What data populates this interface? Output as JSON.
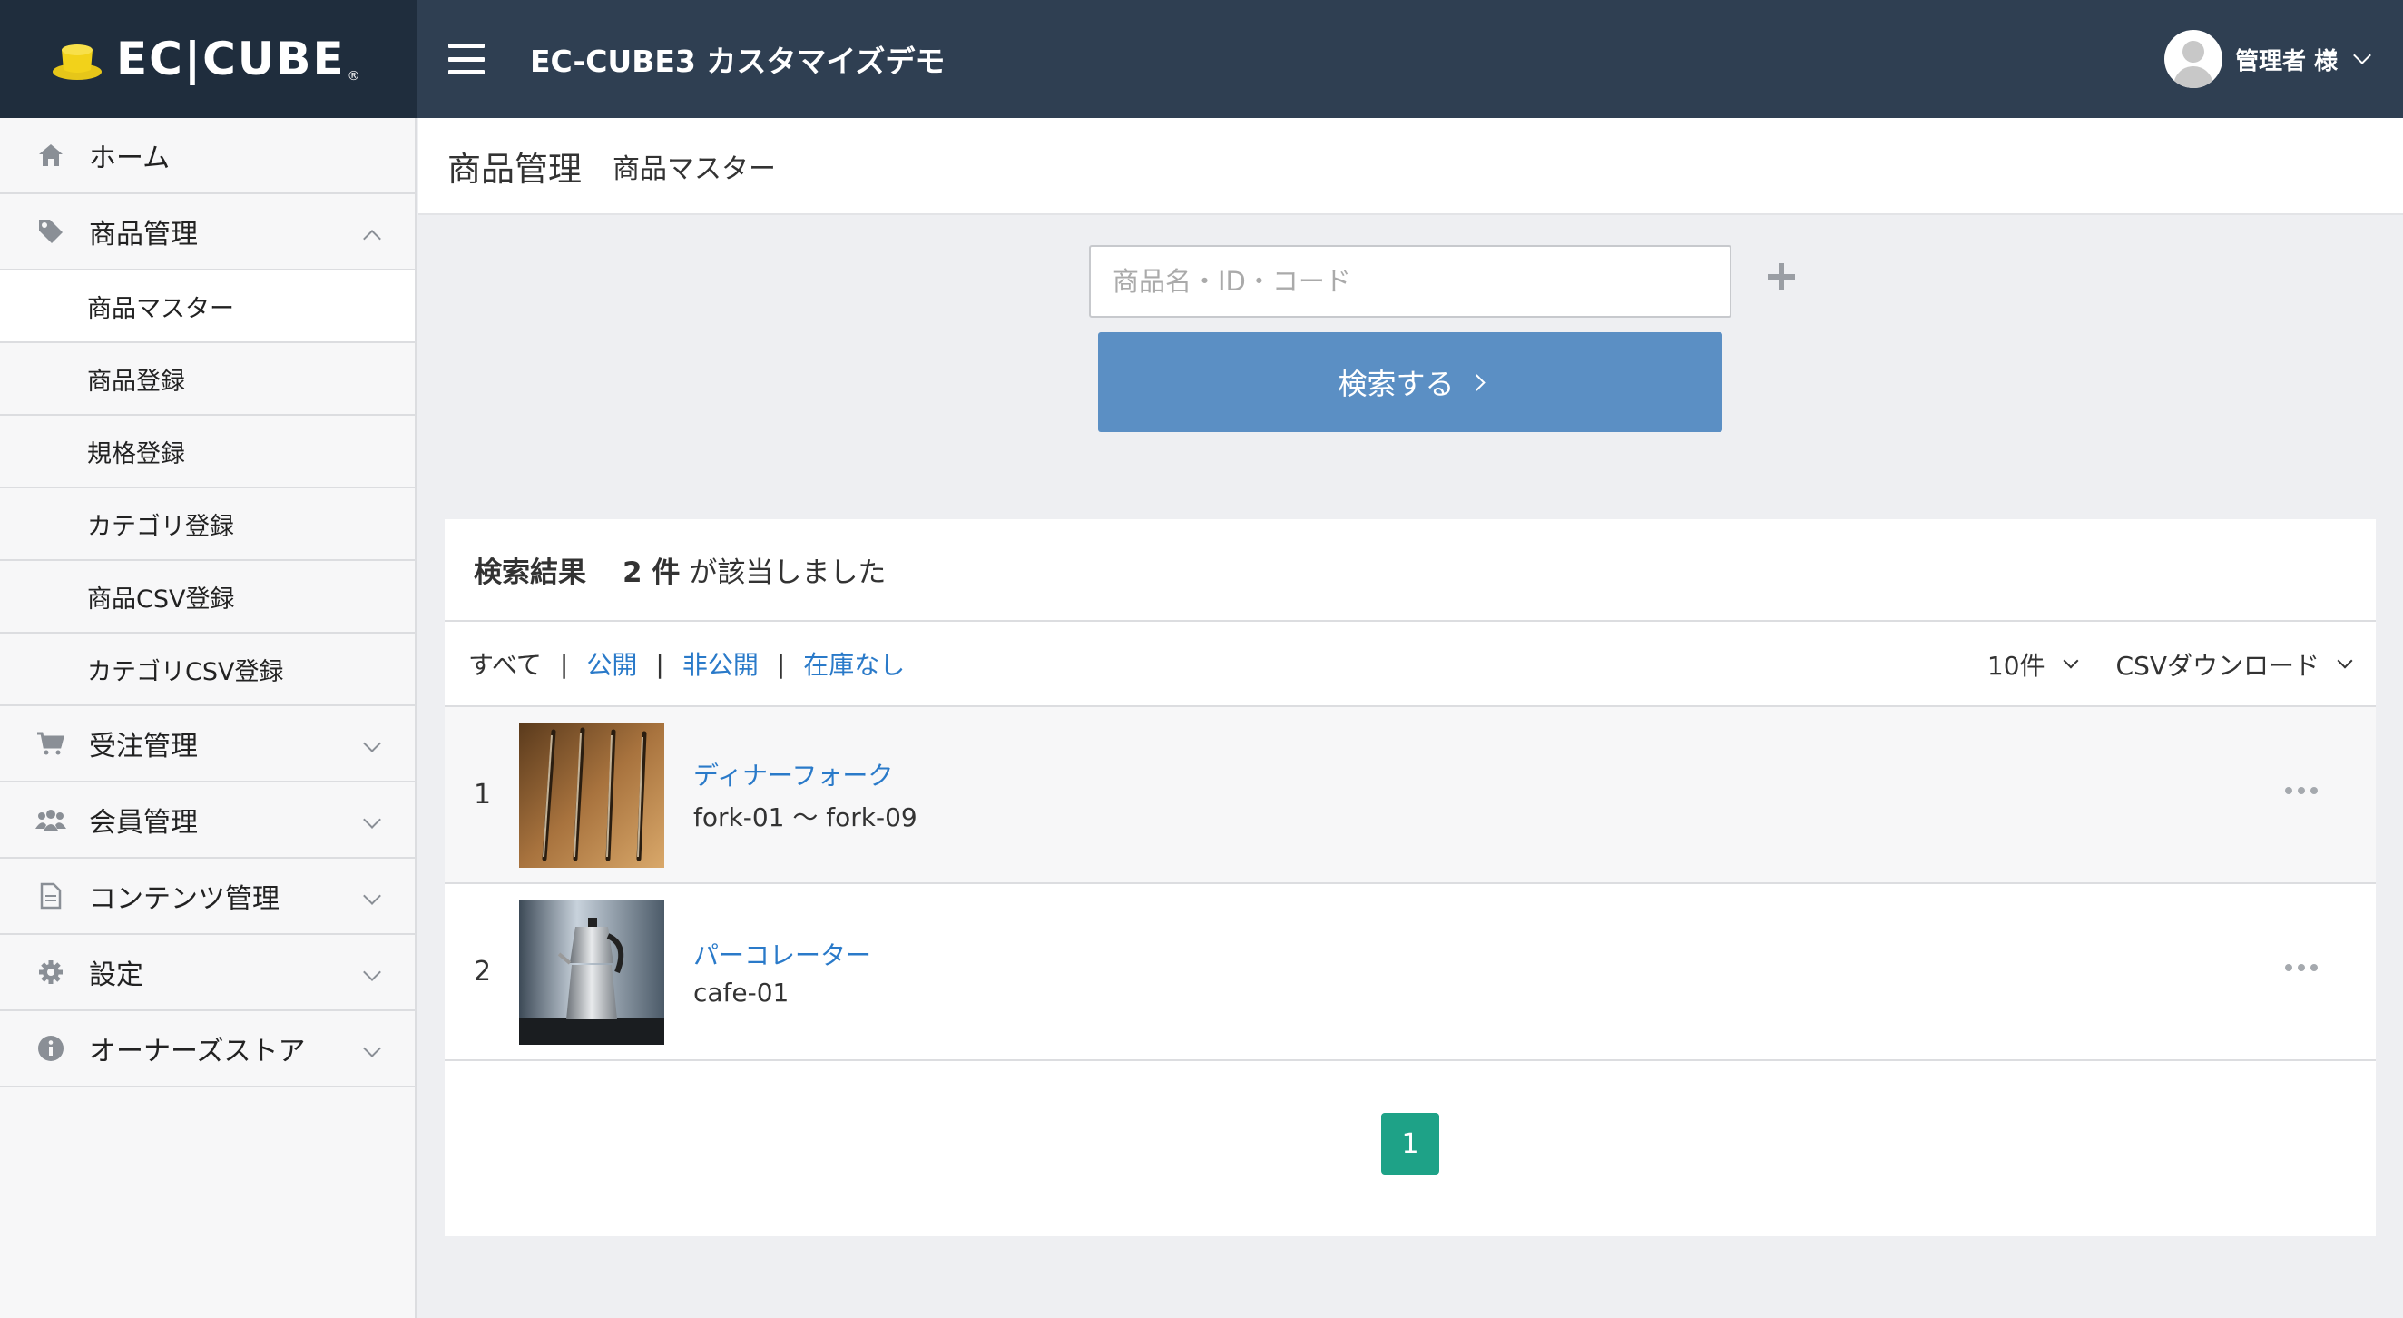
{
  "header": {
    "logo_text": "EC|CUBE",
    "site_title": "EC-CUBE3 カスタマイズデモ",
    "user_name": "管理者 様"
  },
  "sidebar": {
    "items": [
      {
        "label": "ホーム",
        "icon": "home-icon"
      },
      {
        "label": "商品管理",
        "icon": "tag-icon",
        "expanded": true,
        "children": [
          "商品マスター",
          "商品登録",
          "規格登録",
          "カテゴリ登録",
          "商品CSV登録",
          "カテゴリCSV登録"
        ]
      },
      {
        "label": "受注管理",
        "icon": "cart-icon"
      },
      {
        "label": "会員管理",
        "icon": "users-icon"
      },
      {
        "label": "コンテンツ管理",
        "icon": "document-icon"
      },
      {
        "label": "設定",
        "icon": "gear-icon"
      },
      {
        "label": "オーナーズストア",
        "icon": "info-icon"
      }
    ],
    "active_child": "商品マスター"
  },
  "page": {
    "title": "商品管理",
    "subtitle": "商品マスター"
  },
  "search": {
    "placeholder": "商品名・ID・コード",
    "value": "",
    "button_label": "検索する"
  },
  "results": {
    "label": "検索結果",
    "count": "2 件",
    "suffix": "が該当しました",
    "filters": {
      "all": "すべて",
      "public": "公開",
      "private": "非公開",
      "out_of_stock": "在庫なし"
    },
    "per_page": "10件",
    "csv_download": "CSVダウンロード",
    "rows": [
      {
        "no": "1",
        "name": "ディナーフォーク",
        "code": "fork-01 ～ fork-09",
        "image": "forks-photo"
      },
      {
        "no": "2",
        "name": "パーコレーター",
        "code": "cafe-01",
        "image": "percolator-photo"
      }
    ],
    "page": "1"
  },
  "colors": {
    "header_dark": "#1f2d3d",
    "header": "#2f3f52",
    "search_button": "#5b8fc4",
    "link": "#2a7ac9",
    "pager": "#1ea287"
  }
}
